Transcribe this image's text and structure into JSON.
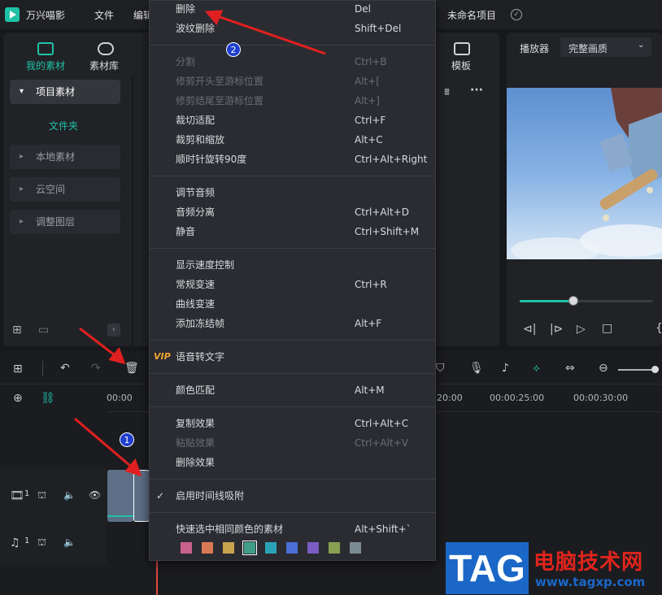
{
  "app": {
    "name": "万兴喵影",
    "menu_file": "文件",
    "menu_edit": "编辑",
    "project_name": "未命名项目"
  },
  "media": {
    "tabs": [
      {
        "label": "我的素材",
        "icon": "folder-media-icon"
      },
      {
        "label": "素材库",
        "icon": "cloud-library-icon"
      },
      {
        "label": "模板",
        "icon": "template-icon"
      }
    ],
    "sidebar": {
      "project_material": "项目素材",
      "folder": "文件夹",
      "items": [
        "本地素材",
        "云空间",
        "调整图层"
      ]
    }
  },
  "player": {
    "label": "播放器",
    "quality": "完整画质",
    "progress": 0.4
  },
  "timeline": {
    "ruler": [
      "00:00",
      "20:00",
      "00:00:25:00",
      "00:00:30:00"
    ],
    "track_video_num": "1",
    "track_audio_num": "1"
  },
  "context_menu": {
    "groups": [
      [
        {
          "label": "删除",
          "shortcut": "Del",
          "enabled": true
        },
        {
          "label": "波纹删除",
          "shortcut": "Shift+Del",
          "enabled": true
        }
      ],
      [
        {
          "label": "分割",
          "shortcut": "Ctrl+B",
          "enabled": false
        },
        {
          "label": "修剪开头至游标位置",
          "shortcut": "Alt+[",
          "enabled": false
        },
        {
          "label": "修剪结尾至游标位置",
          "shortcut": "Alt+]",
          "enabled": false
        },
        {
          "label": "裁切适配",
          "shortcut": "Ctrl+F",
          "enabled": true
        },
        {
          "label": "裁剪和缩放",
          "shortcut": "Alt+C",
          "enabled": true
        },
        {
          "label": "顺时针旋转90度",
          "shortcut": "Ctrl+Alt+Right",
          "enabled": true
        }
      ],
      [
        {
          "label": "调节音频",
          "shortcut": "",
          "enabled": true
        },
        {
          "label": "音频分离",
          "shortcut": "Ctrl+Alt+D",
          "enabled": true
        },
        {
          "label": "静音",
          "shortcut": "Ctrl+Shift+M",
          "enabled": true
        }
      ],
      [
        {
          "label": "显示速度控制",
          "shortcut": "",
          "enabled": true
        },
        {
          "label": "常规变速",
          "shortcut": "Ctrl+R",
          "enabled": true
        },
        {
          "label": "曲线变速",
          "shortcut": "",
          "enabled": true
        },
        {
          "label": "添加冻结帧",
          "shortcut": "Alt+F",
          "enabled": true
        }
      ],
      [
        {
          "label": "语音转文字",
          "shortcut": "",
          "enabled": true,
          "vip": "VIP"
        }
      ],
      [
        {
          "label": "颜色匹配",
          "shortcut": "Alt+M",
          "enabled": true
        }
      ],
      [
        {
          "label": "复制效果",
          "shortcut": "Ctrl+Alt+C",
          "enabled": true
        },
        {
          "label": "粘贴效果",
          "shortcut": "Ctrl+Alt+V",
          "enabled": false
        },
        {
          "label": "删除效果",
          "shortcut": "",
          "enabled": true
        }
      ],
      [
        {
          "label": "启用时间线吸附",
          "shortcut": "",
          "enabled": true,
          "checked": true
        }
      ],
      [
        {
          "label": "快速选中相同颜色的素材",
          "shortcut": "Alt+Shift+`",
          "enabled": true
        }
      ]
    ],
    "swatches": [
      "#c8628a",
      "#d97a55",
      "#c9a44f",
      "#3f9e88",
      "#2aa3b8",
      "#4a6fd4",
      "#7a5cc4",
      "#8aa052",
      "#7c8a93"
    ]
  },
  "annotations": {
    "badge_1": "1",
    "badge_2": "2",
    "arrow_color": "#e02020"
  },
  "watermark": {
    "tag": "TAG",
    "site_name": "电脑技术网",
    "url": "www.tagxp.com"
  }
}
